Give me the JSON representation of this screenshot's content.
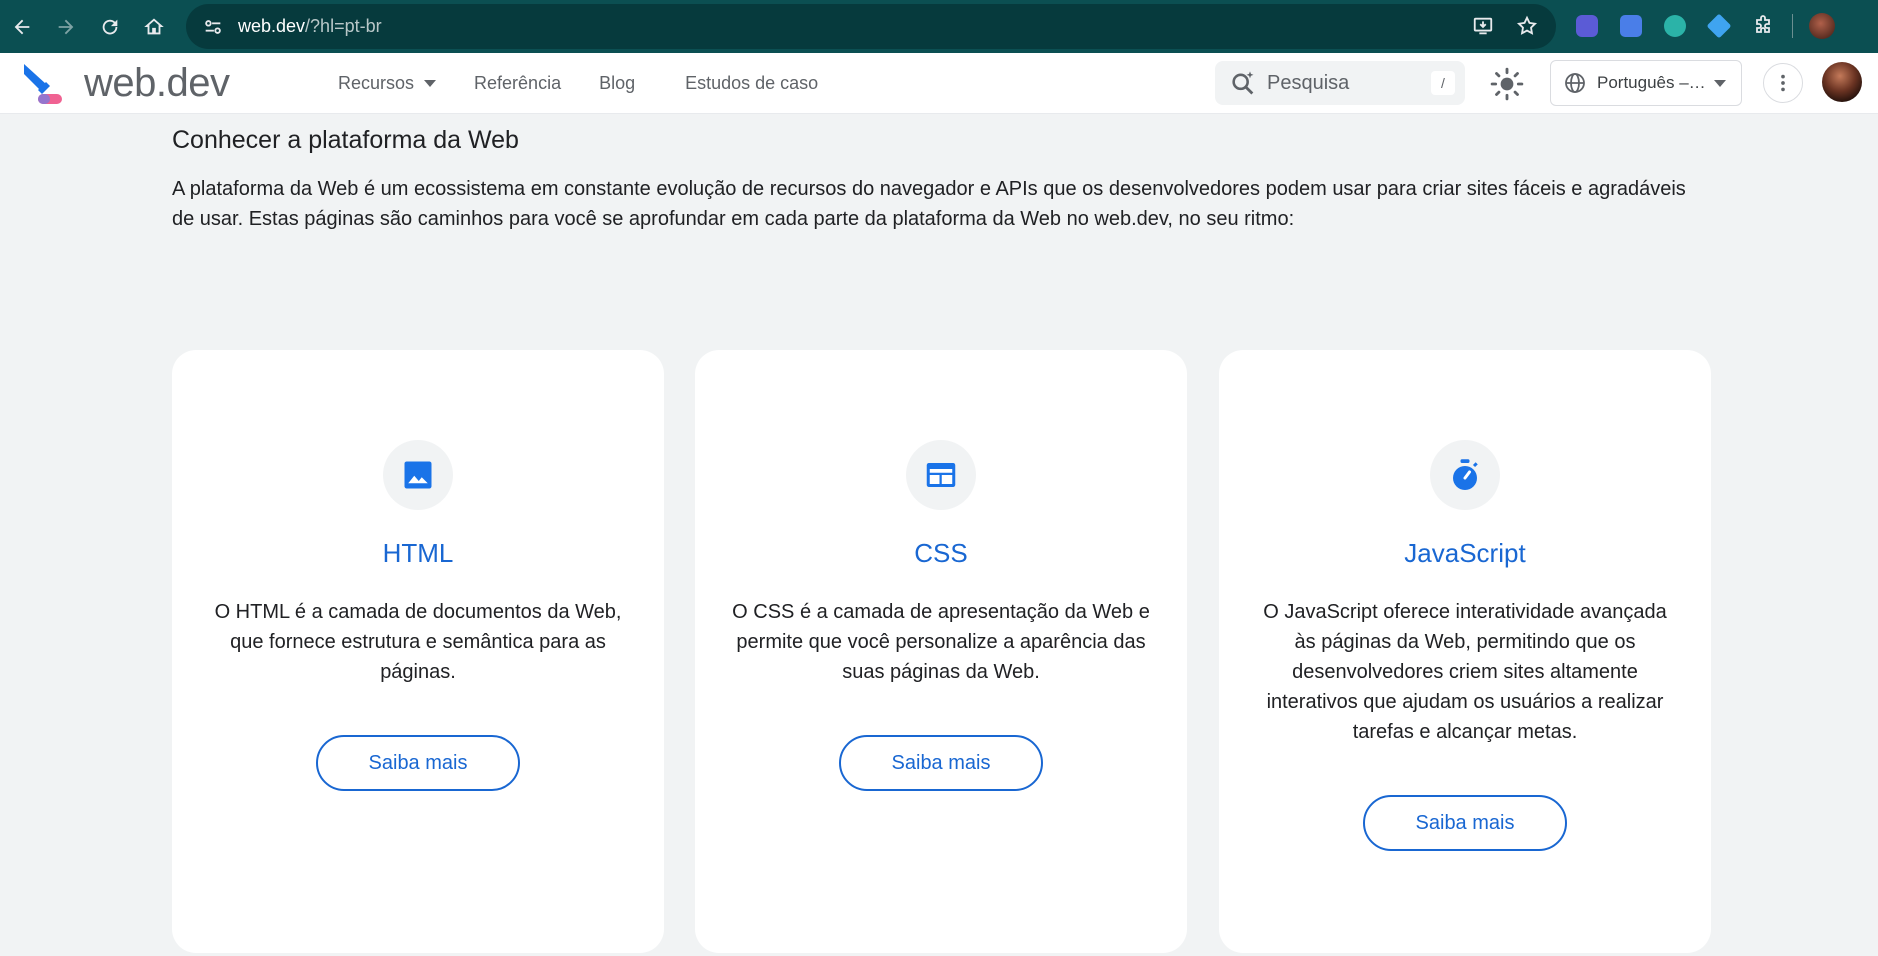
{
  "browser": {
    "url_host": "web.dev",
    "url_rest": "/?hl=pt-br"
  },
  "header": {
    "logo_text": "web.dev",
    "nav": [
      {
        "label": "Recursos"
      },
      {
        "label": "Referência"
      },
      {
        "label": "Blog"
      },
      {
        "label": "Estudos de caso"
      }
    ],
    "search_placeholder": "Pesquisa",
    "search_shortcut": "/",
    "language": "Português –…"
  },
  "main": {
    "title": "Conhecer a plataforma da Web",
    "description": "A plataforma da Web é um ecossistema em constante evolução de recursos do navegador e APIs que os desenvolvedores podem usar para criar sites fáceis e agradáveis de usar. Estas páginas são caminhos para você se aprofundar em cada parte da plataforma da Web no web.dev, no seu ritmo:",
    "cards": [
      {
        "icon": "image-icon",
        "title": "HTML",
        "text": "O HTML é a camada de documentos da Web, que fornece estrutura e semântica para as páginas.",
        "button": "Saiba mais"
      },
      {
        "icon": "web-layout-icon",
        "title": "CSS",
        "text": "O CSS é a camada de apresentação da Web e permite que você personalize a aparência das suas páginas da Web.",
        "button": "Saiba mais"
      },
      {
        "icon": "timer-icon",
        "title": "JavaScript",
        "text": "O JavaScript oferece interatividade avançada às páginas da Web, permitindo que os desenvolvedores criem sites altamente interativos que ajudam os usuários a realizar tarefas e alcançar metas.",
        "button": "Saiba mais"
      }
    ]
  },
  "colors": {
    "chrome_bg": "#0b4f52",
    "accent": "#1967d2",
    "page_bg": "#f1f3f4"
  }
}
